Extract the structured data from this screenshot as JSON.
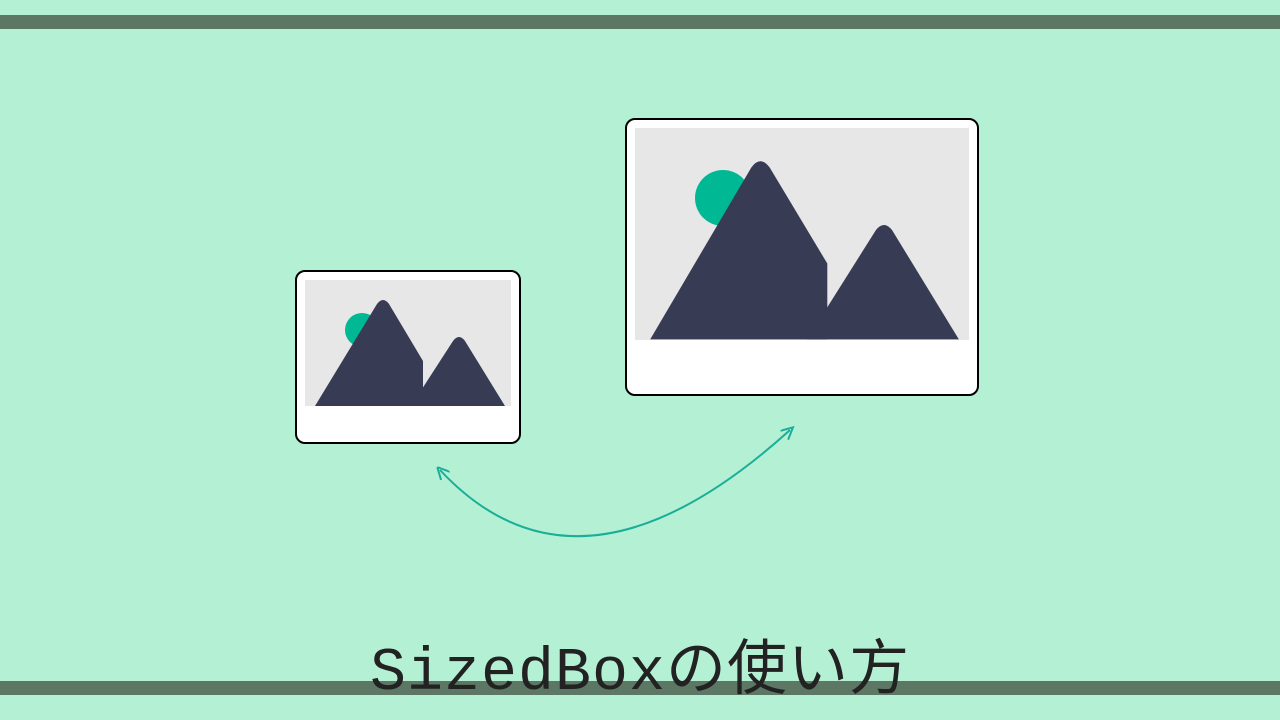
{
  "title": "SizedBoxの使い方",
  "colors": {
    "background": "#b4f0d4",
    "bar": "#5c7763",
    "mountain": "#373b54",
    "sun": "#00b894",
    "arrow": "#1aae98",
    "card_bg": "#ffffff",
    "image_placeholder_bg": "#e7e7e7"
  },
  "cards": {
    "small": {
      "label": "small-image-placeholder"
    },
    "large": {
      "label": "large-image-placeholder"
    }
  }
}
